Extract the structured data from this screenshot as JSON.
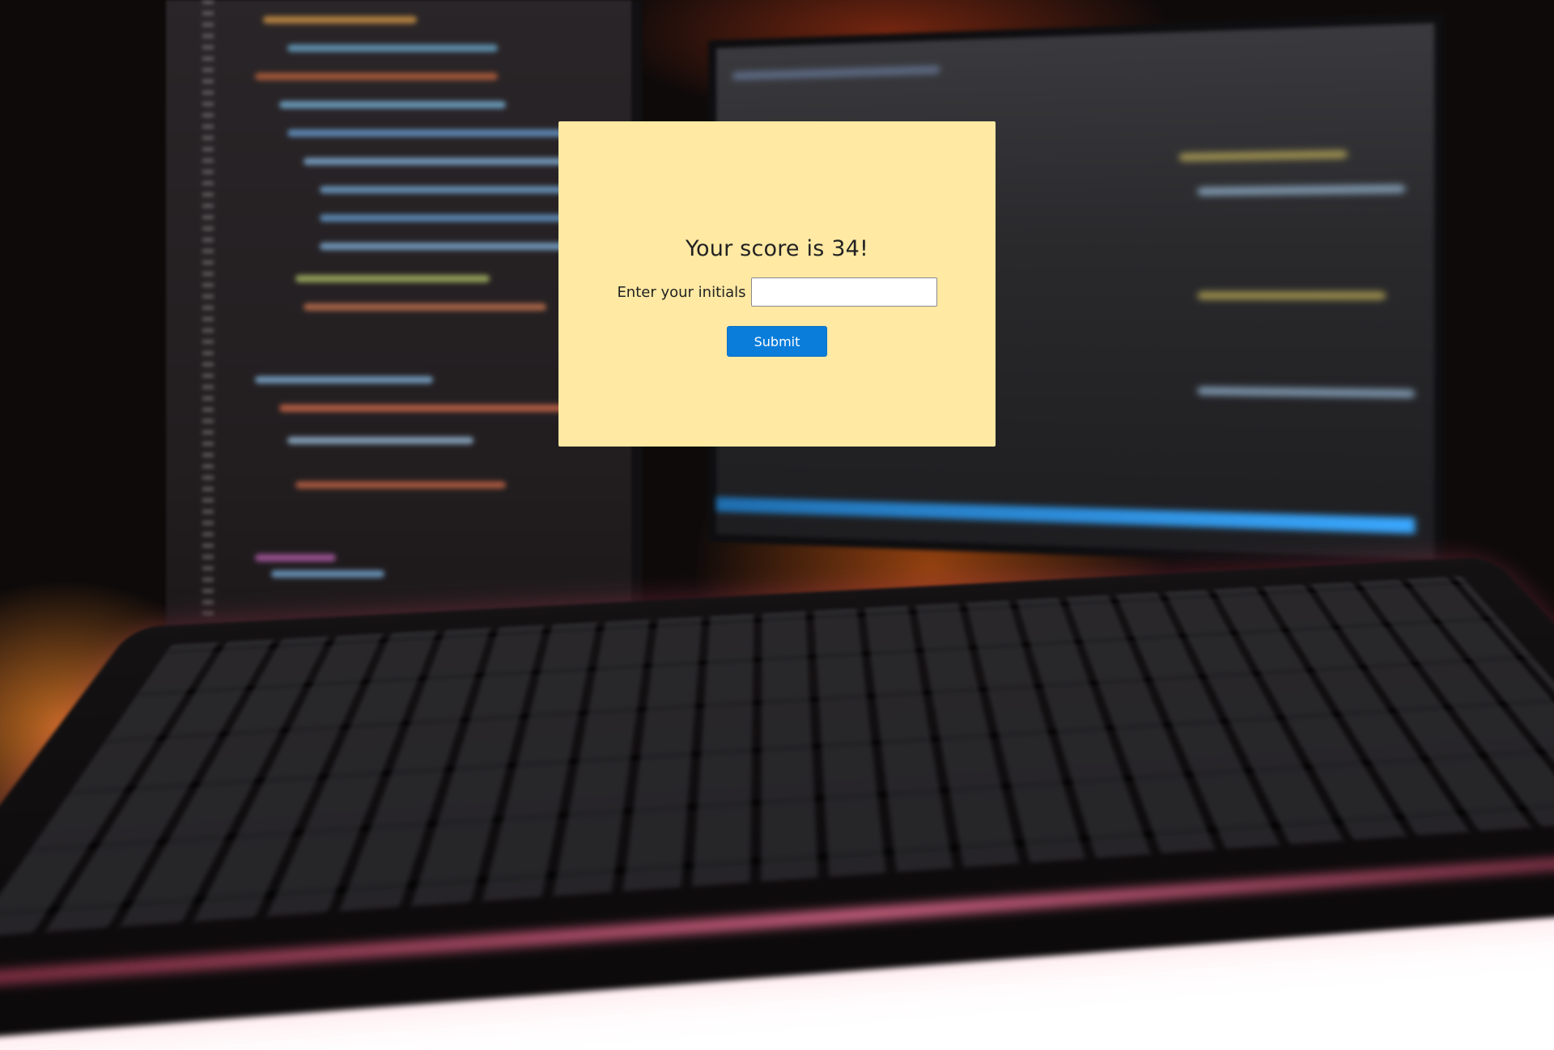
{
  "background": {
    "description_icon": "desk-with-monitors-and-keyboard-photo",
    "accent_orange": "#ff8c28",
    "accent_pink": "#ff7aa0"
  },
  "modal": {
    "background_color": "#ffe9a3",
    "score_text": "Your score is 34!",
    "initials_label": "Enter your initials",
    "initials_value": "",
    "initials_placeholder": "",
    "submit_label": "Submit",
    "submit_color": "#0a7ddb"
  }
}
